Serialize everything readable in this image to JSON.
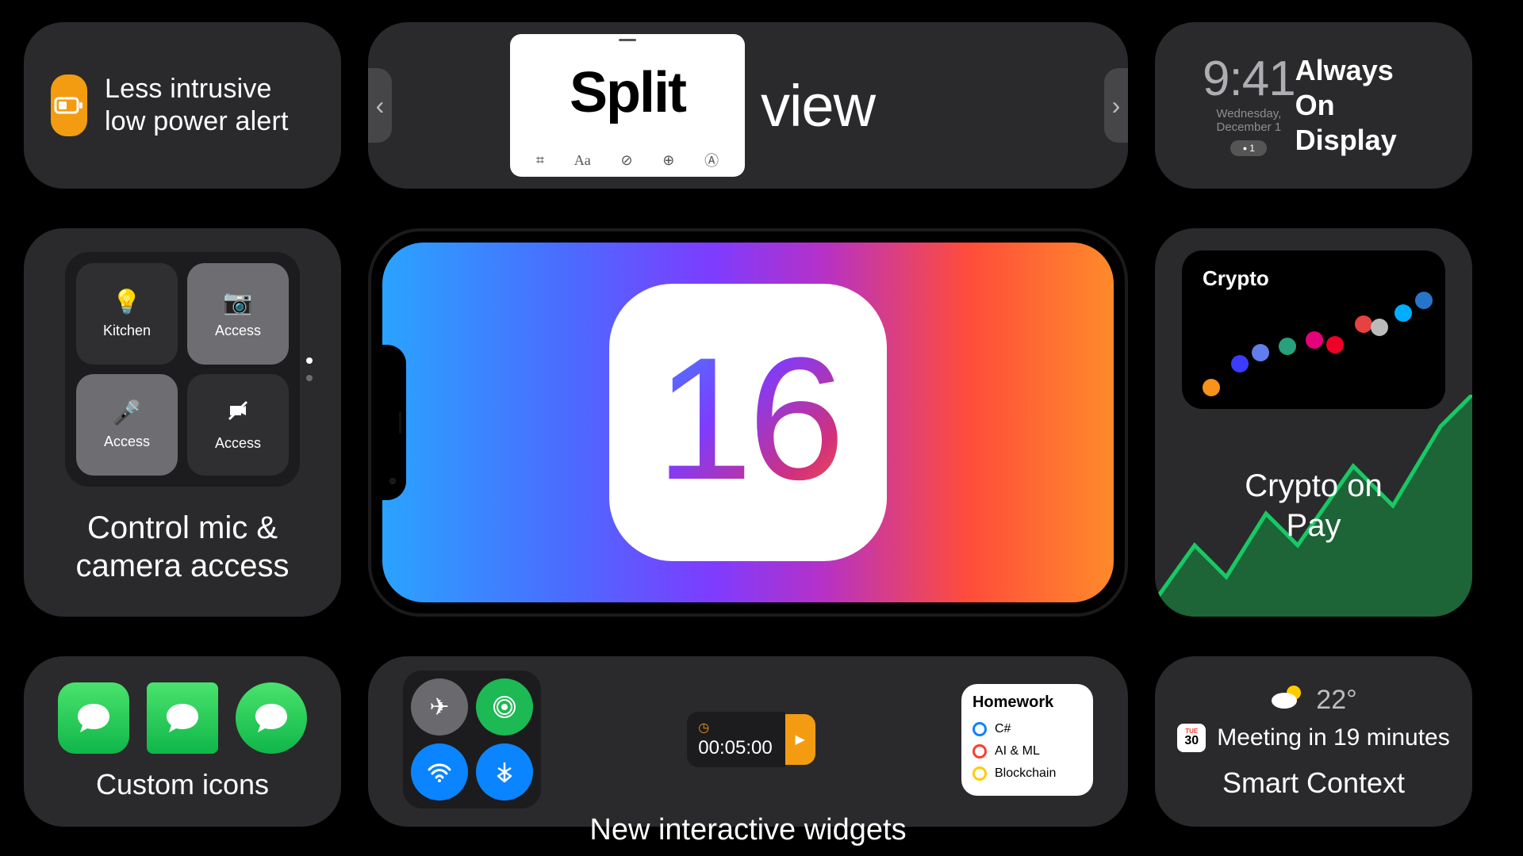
{
  "low_power": {
    "title": "Less intrusive low power alert"
  },
  "split": {
    "word_in_app": "Split",
    "word_outside": "view"
  },
  "aod": {
    "time": "9:41",
    "date": "Wednesday, December 1",
    "notif_count": "1",
    "label": "Always On Display"
  },
  "mic_cam": {
    "buttons": [
      {
        "label": "Kitchen",
        "icon": "bulb",
        "on": false
      },
      {
        "label": "Access",
        "icon": "camera",
        "on": true
      },
      {
        "label": "Access",
        "icon": "mic",
        "on": true
      },
      {
        "label": "Access",
        "icon": "novideo",
        "on": false
      }
    ],
    "title": "Control mic & camera access"
  },
  "ios_version": "16",
  "crypto": {
    "header": "Crypto",
    "title_line1": "Crypto on",
    "title_line2": " Pay"
  },
  "custom_icons": {
    "label": "Custom icons"
  },
  "widgets": {
    "timer": "00:05:00",
    "homework_title": "Homework",
    "tasks": [
      {
        "label": "C#",
        "color": "#0a84ff"
      },
      {
        "label": "AI & ML",
        "color": "#ff3b30"
      },
      {
        "label": "Blockchain",
        "color": "#ffcc00"
      }
    ],
    "caption": "New interactive widgets"
  },
  "context": {
    "temp": "22°",
    "cal_month": "TUE",
    "cal_day": "30",
    "meeting": "Meeting in 19 minutes",
    "caption": "Smart Context"
  }
}
